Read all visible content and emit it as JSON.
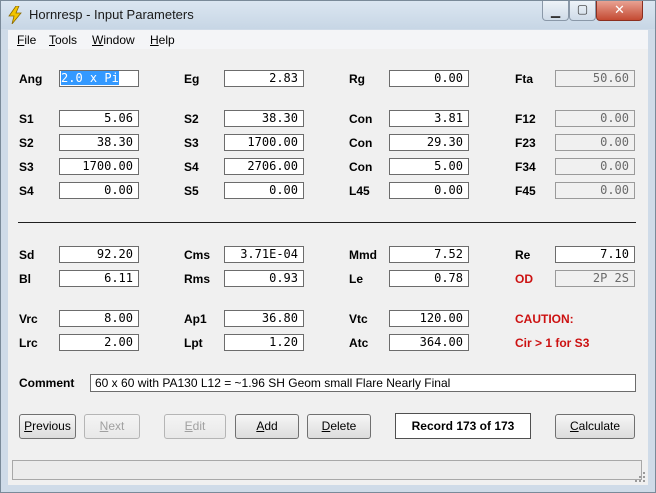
{
  "window": {
    "title": "Hornresp - Input Parameters"
  },
  "menu": [
    {
      "key": "F",
      "rest": "ile"
    },
    {
      "key": "T",
      "rest": "ools"
    },
    {
      "key": "W",
      "rest": "indow"
    },
    {
      "key": "H",
      "rest": "elp"
    }
  ],
  "row_ang": {
    "ang_label": "Ang",
    "ang_value": "2.0 x Pi",
    "eg_label": "Eg",
    "eg_value": "2.83",
    "rg_label": "Rg",
    "rg_value": "0.00",
    "fta_label": "Fta",
    "fta_value": "50.60"
  },
  "row1": {
    "a_label": "S1",
    "a_value": "5.06",
    "b_label": "S2",
    "b_value": "38.30",
    "c_label": "Con",
    "c_value": "3.81",
    "d_label": "F12",
    "d_value": "0.00"
  },
  "row2": {
    "a_label": "S2",
    "a_value": "38.30",
    "b_label": "S3",
    "b_value": "1700.00",
    "c_label": "Con",
    "c_value": "29.30",
    "d_label": "F23",
    "d_value": "0.00"
  },
  "row3": {
    "a_label": "S3",
    "a_value": "1700.00",
    "b_label": "S4",
    "b_value": "2706.00",
    "c_label": "Con",
    "c_value": "5.00",
    "d_label": "F34",
    "d_value": "0.00"
  },
  "row4": {
    "a_label": "S4",
    "a_value": "0.00",
    "b_label": "S5",
    "b_value": "0.00",
    "c_label": "L45",
    "c_value": "0.00",
    "d_label": "F45",
    "d_value": "0.00"
  },
  "driver1": {
    "sd_label": "Sd",
    "sd_value": "92.20",
    "cms_label": "Cms",
    "cms_value": "3.71E-04",
    "mmd_label": "Mmd",
    "mmd_value": "7.52",
    "re_label": "Re",
    "re_value": "7.10"
  },
  "driver2": {
    "bl_label": "Bl",
    "bl_value": "6.11",
    "rms_label": "Rms",
    "rms_value": "0.93",
    "le_label": "Le",
    "le_value": "0.78",
    "od_label": "OD",
    "od_value": "2P 2S"
  },
  "chamber1": {
    "vrc_label": "Vrc",
    "vrc_value": "8.00",
    "ap1_label": "Ap1",
    "ap1_value": "36.80",
    "vtc_label": "Vtc",
    "vtc_value": "120.00",
    "caution_label": "CAUTION:"
  },
  "chamber2": {
    "lrc_label": "Lrc",
    "lrc_value": "2.00",
    "lpt_label": "Lpt",
    "lpt_value": "1.20",
    "atc_label": "Atc",
    "atc_value": "364.00",
    "caution_text": "Cir > 1 for S3"
  },
  "comment": {
    "label": "Comment",
    "value": "60 x 60 with PA130 L12 = ~1.96 SH Geom small Flare Nearly Final"
  },
  "buttons": {
    "previous": {
      "key": "P",
      "rest": "revious"
    },
    "next": {
      "key": "N",
      "rest": "ext"
    },
    "edit": {
      "key": "E",
      "rest": "dit"
    },
    "add": {
      "key": "A",
      "rest": "dd"
    },
    "delete": {
      "key": "D",
      "rest": "elete"
    },
    "record": "Record 173 of 173",
    "calculate": {
      "key": "C",
      "rest": "alculate"
    }
  },
  "colors": {
    "accent_red": "#cc1111",
    "selection": "#3399ff",
    "title_icon": "#f2c400"
  }
}
